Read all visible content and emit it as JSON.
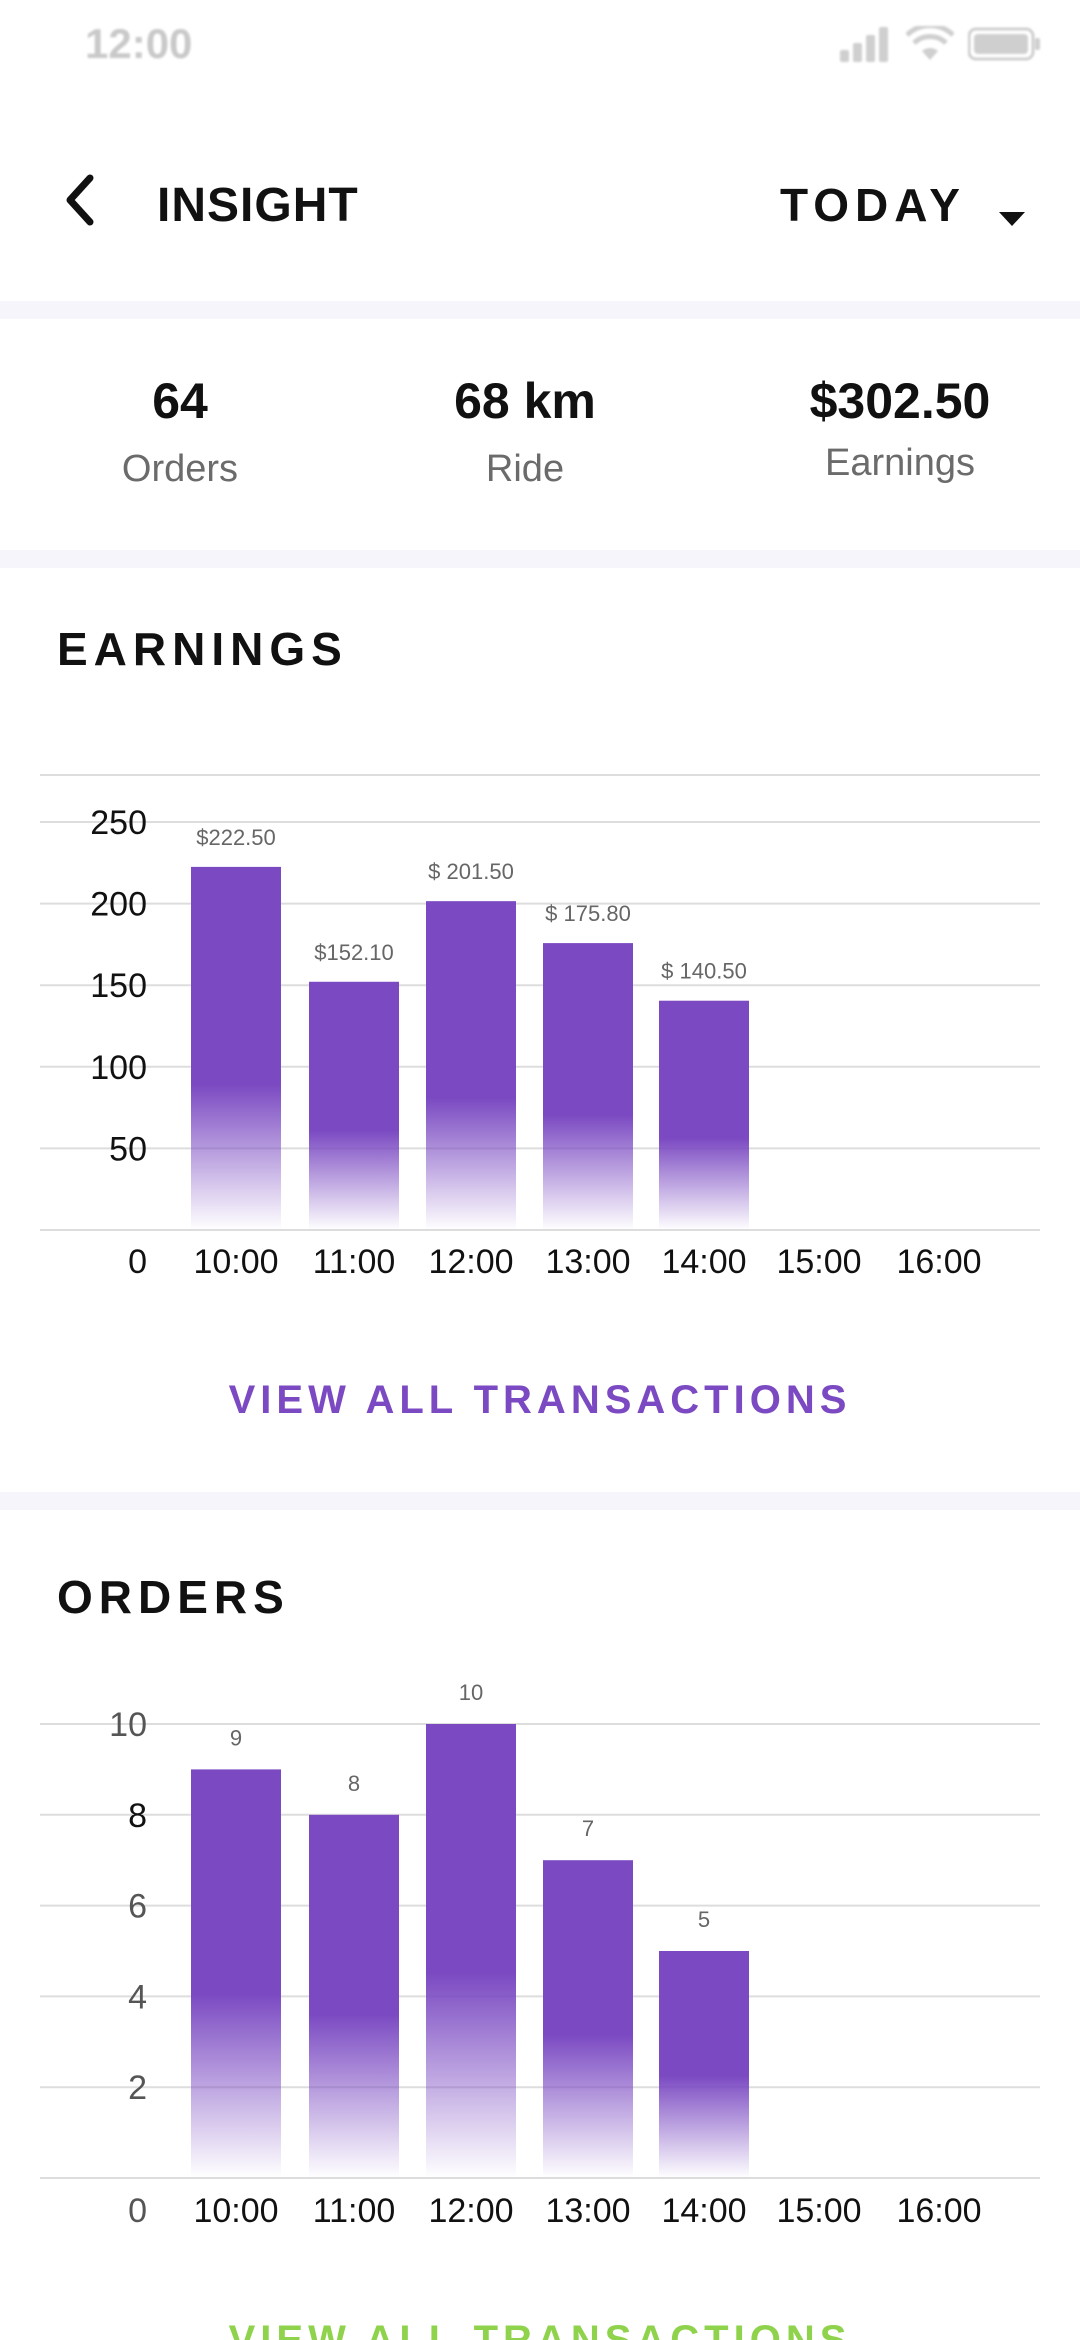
{
  "status_bar": {
    "time": "12:00"
  },
  "header": {
    "title": "INSIGHT",
    "period": "TODAY"
  },
  "stats": [
    {
      "value": "64",
      "label": "Orders"
    },
    {
      "value": "68 km",
      "label": "Ride"
    },
    {
      "value": "$302.50",
      "label": "Earnings"
    }
  ],
  "earnings_section": {
    "title": "EARNINGS",
    "view_all": "VIEW ALL TRANSACTIONS"
  },
  "orders_section": {
    "title": "ORDERS",
    "view_all": "VIEW ALL TRANSACTIONS"
  },
  "colors": {
    "accent": "#7b4ac2",
    "link_purple": "#7b4ac2",
    "link_green": "#8ed34b",
    "divider": "#f6f5fb"
  },
  "chart_data": [
    {
      "type": "bar",
      "categories": [
        "10:00",
        "11:00",
        "12:00",
        "13:00",
        "14:00",
        "15:00",
        "16:00"
      ],
      "values": [
        222.5,
        152.1,
        201.5,
        175.8,
        140.5,
        null,
        null
      ],
      "data_labels": [
        "$222.50",
        "$152.10",
        "$ 201.50",
        "$ 175.80",
        "$ 140.50",
        "",
        ""
      ],
      "yticks": [
        0,
        50,
        100,
        150,
        200,
        250
      ],
      "ylim": [
        0,
        250
      ],
      "grid": true
    },
    {
      "type": "bar",
      "categories": [
        "10:00",
        "11:00",
        "12:00",
        "13:00",
        "14:00",
        "15:00",
        "16:00"
      ],
      "values": [
        9,
        8,
        10,
        7,
        5,
        null,
        null
      ],
      "data_labels": [
        "9",
        "8",
        "10",
        "7",
        "5",
        "",
        ""
      ],
      "yticks": [
        0,
        2,
        4,
        6,
        8,
        10
      ],
      "ylim": [
        0,
        10
      ],
      "grid": true
    }
  ]
}
